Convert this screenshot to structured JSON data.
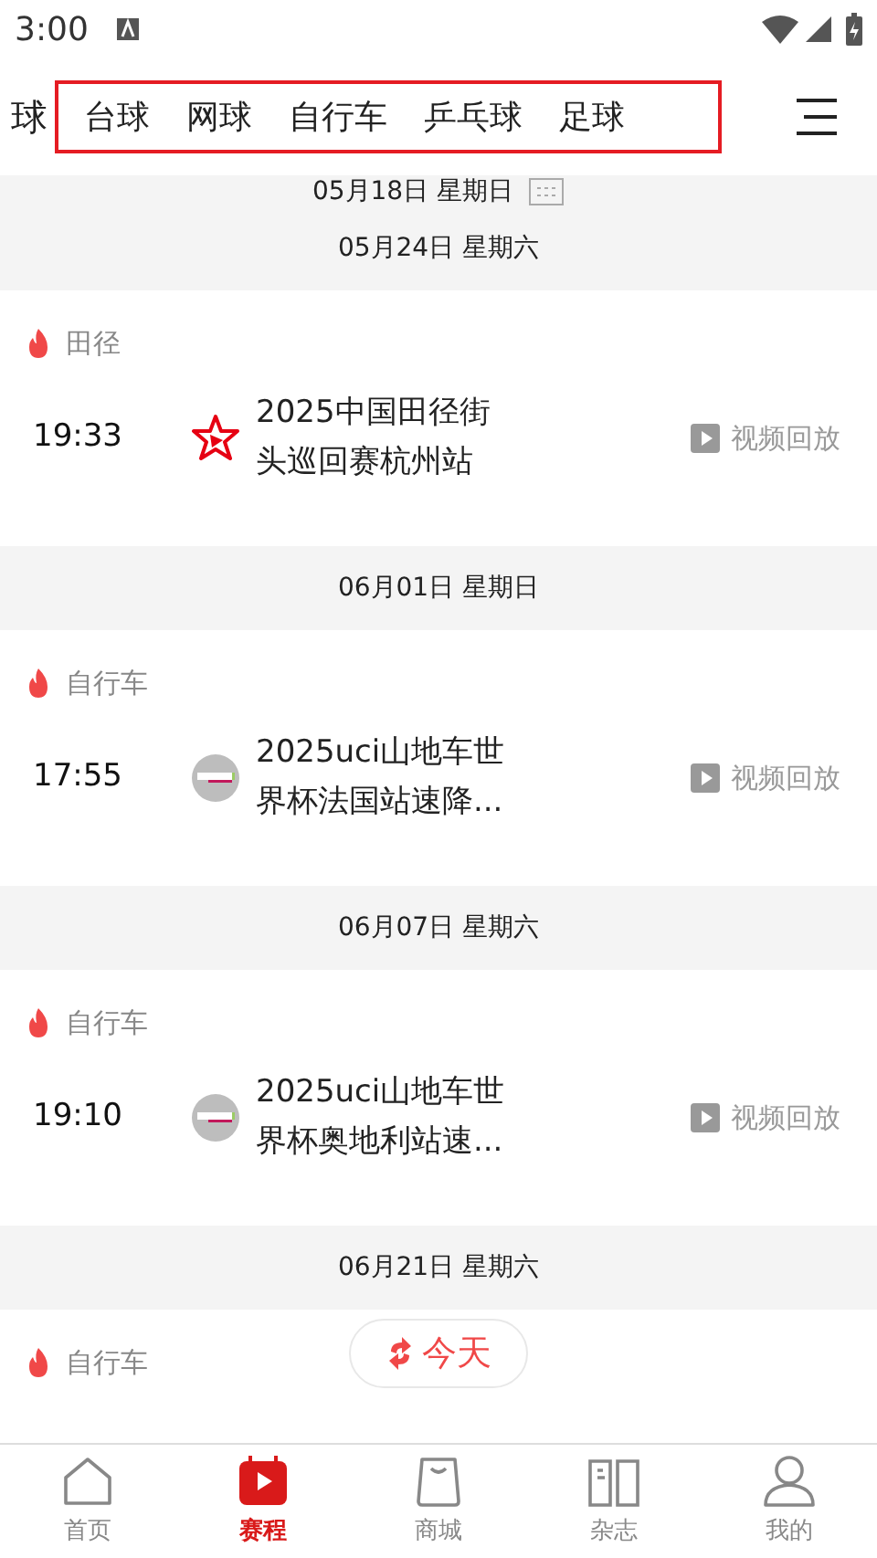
{
  "status_bar": {
    "time": "3:00"
  },
  "tabs": [
    {
      "label": "球",
      "selected": false
    },
    {
      "label": "台球",
      "selected": false
    },
    {
      "label": "网球",
      "selected": false
    },
    {
      "label": "自行车",
      "selected": false
    },
    {
      "label": "乒乓球",
      "selected": false
    },
    {
      "label": "足球",
      "selected": false
    }
  ],
  "top_date": "05月18日 星期日",
  "days": [
    {
      "date": "05月24日 星期六",
      "events": [
        {
          "category": "田径",
          "time": "19:33",
          "kind": "star",
          "title": "2025中国田径街头巡回赛杭州站",
          "action": "视频回放"
        }
      ]
    },
    {
      "date": "06月01日 星期日",
      "events": [
        {
          "category": "自行车",
          "time": "17:55",
          "kind": "round",
          "title": "2025uci山地车世界杯法国站速降...",
          "action": "视频回放"
        }
      ]
    },
    {
      "date": "06月07日 星期六",
      "events": [
        {
          "category": "自行车",
          "time": "19:10",
          "kind": "round",
          "title": "2025uci山地车世界杯奥地利站速...",
          "action": "视频回放"
        }
      ]
    },
    {
      "date": "06月21日 星期六",
      "events": [
        {
          "category": "自行车"
        }
      ]
    }
  ],
  "today_button": "今天",
  "bottom_nav": [
    {
      "label": "首页",
      "kind": "home",
      "selected": false
    },
    {
      "label": "赛程",
      "kind": "schedule",
      "selected": true
    },
    {
      "label": "商城",
      "kind": "bag",
      "selected": false
    },
    {
      "label": "杂志",
      "kind": "book",
      "selected": false
    },
    {
      "label": "我的",
      "kind": "user",
      "selected": false
    }
  ]
}
